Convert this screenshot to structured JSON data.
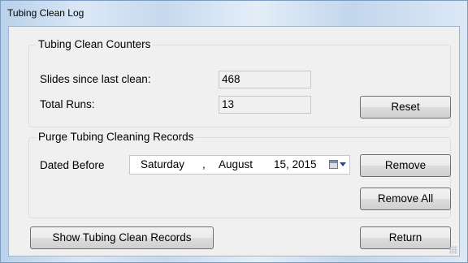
{
  "window": {
    "title": "Tubing Clean Log"
  },
  "counters": {
    "group_title": "Tubing Clean Counters",
    "slides_label": "Slides since last clean:",
    "slides_value": "468",
    "total_runs_label": "Total Runs:",
    "total_runs_value": "13",
    "reset_label": "Reset"
  },
  "purge": {
    "group_title": "Purge Tubing Cleaning Records",
    "dated_before_label": "Dated Before",
    "date": {
      "weekday": "Saturday",
      "separator": ",",
      "month": "August",
      "day_year": "15, 2015"
    },
    "remove_label": "Remove",
    "remove_all_label": "Remove All"
  },
  "footer": {
    "show_records_label": "Show Tubing Clean Records",
    "return_label": "Return"
  },
  "icons": {
    "calendar": "calendar-icon",
    "dropdown": "chevron-down-icon",
    "grip": "resize-grip-icon"
  }
}
